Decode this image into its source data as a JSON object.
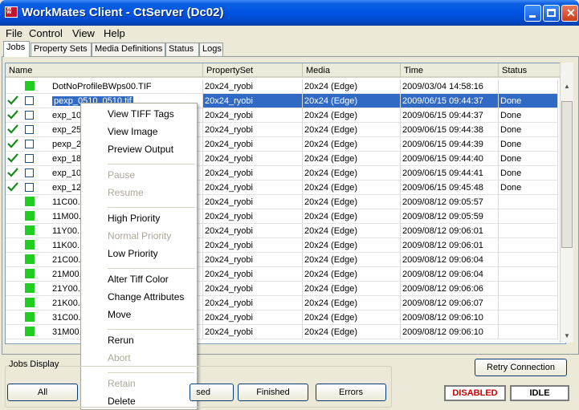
{
  "window": {
    "title": "WorkMates Client - CtServer (Dc02)"
  },
  "menu": [
    "File",
    "Control",
    "View",
    "Help"
  ],
  "tabs": [
    "Jobs",
    "Property Sets",
    "Media Definitions",
    "Status",
    "Logs"
  ],
  "columns": [
    "Name",
    "PropertySet",
    "Media",
    "Time",
    "Status"
  ],
  "rows": [
    {
      "check": false,
      "box": "green",
      "name": "DotNoProfileBWps00.TIF",
      "property_set": "20x24_ryobi",
      "media": "20x24 (Edge)",
      "time": "2009/03/04 14:58:16",
      "status": ""
    },
    {
      "check": true,
      "box": "empty",
      "name": "pexp_0510_0510.tif",
      "property_set": "20x24_ryobi",
      "media": "20x24 (Edge)",
      "time": "2009/06/15 09:44:37",
      "status": "Done"
    },
    {
      "check": true,
      "box": "empty",
      "name": "exp_10",
      "property_set": "20x24_ryobi",
      "media": "20x24 (Edge)",
      "time": "2009/06/15 09:44:37",
      "status": "Done"
    },
    {
      "check": true,
      "box": "empty",
      "name": "exp_25",
      "property_set": "20x24_ryobi",
      "media": "20x24 (Edge)",
      "time": "2009/06/15 09:44:38",
      "status": "Done"
    },
    {
      "check": true,
      "box": "empty",
      "name": "pexp_2",
      "property_set": "20x24_ryobi",
      "media": "20x24 (Edge)",
      "time": "2009/06/15 09:44:39",
      "status": "Done"
    },
    {
      "check": true,
      "box": "empty",
      "name": "exp_18",
      "property_set": "20x24_ryobi",
      "media": "20x24 (Edge)",
      "time": "2009/06/15 09:44:40",
      "status": "Done"
    },
    {
      "check": true,
      "box": "empty",
      "name": "exp_10",
      "property_set": "20x24_ryobi",
      "media": "20x24 (Edge)",
      "time": "2009/06/15 09:44:41",
      "status": "Done"
    },
    {
      "check": true,
      "box": "empty",
      "name": "exp_12",
      "property_set": "20x24_ryobi",
      "media": "20x24 (Edge)",
      "time": "2009/06/15 09:45:48",
      "status": "Done"
    },
    {
      "check": false,
      "box": "green",
      "name": "11C00.",
      "property_set": "20x24_ryobi",
      "media": "20x24 (Edge)",
      "time": "2009/08/12 09:05:57",
      "status": ""
    },
    {
      "check": false,
      "box": "green",
      "name": "11M00.",
      "property_set": "20x24_ryobi",
      "media": "20x24 (Edge)",
      "time": "2009/08/12 09:05:59",
      "status": ""
    },
    {
      "check": false,
      "box": "green",
      "name": "11Y00.",
      "property_set": "20x24_ryobi",
      "media": "20x24 (Edge)",
      "time": "2009/08/12 09:06:01",
      "status": ""
    },
    {
      "check": false,
      "box": "green",
      "name": "11K00.",
      "property_set": "20x24_ryobi",
      "media": "20x24 (Edge)",
      "time": "2009/08/12 09:06:01",
      "status": ""
    },
    {
      "check": false,
      "box": "green",
      "name": "21C00.",
      "property_set": "20x24_ryobi",
      "media": "20x24 (Edge)",
      "time": "2009/08/12 09:06:04",
      "status": ""
    },
    {
      "check": false,
      "box": "green",
      "name": "21M00.",
      "property_set": "20x24_ryobi",
      "media": "20x24 (Edge)",
      "time": "2009/08/12 09:06:04",
      "status": ""
    },
    {
      "check": false,
      "box": "green",
      "name": "21Y00.",
      "property_set": "20x24_ryobi",
      "media": "20x24 (Edge)",
      "time": "2009/08/12 09:06:06",
      "status": ""
    },
    {
      "check": false,
      "box": "green",
      "name": "21K00.",
      "property_set": "20x24_ryobi",
      "media": "20x24 (Edge)",
      "time": "2009/08/12 09:06:07",
      "status": ""
    },
    {
      "check": false,
      "box": "green",
      "name": "31C00.",
      "property_set": "20x24_ryobi",
      "media": "20x24 (Edge)",
      "time": "2009/08/12 09:06:10",
      "status": ""
    },
    {
      "check": false,
      "box": "green",
      "name": "31M00.",
      "property_set": "20x24_ryobi",
      "media": "20x24 (Edge)",
      "time": "2009/08/12 09:06:10",
      "status": ""
    }
  ],
  "context_menu": [
    {
      "label": "View TIFF Tags",
      "enabled": true
    },
    {
      "label": "View Image",
      "enabled": true
    },
    {
      "label": "Preview Output",
      "enabled": true
    },
    {
      "sep": true
    },
    {
      "label": "Pause",
      "enabled": false
    },
    {
      "label": "Resume",
      "enabled": false
    },
    {
      "sep": true
    },
    {
      "label": "High Priority",
      "enabled": true
    },
    {
      "label": "Normal Priority",
      "enabled": false
    },
    {
      "label": "Low Priority",
      "enabled": true
    },
    {
      "sep": true
    },
    {
      "label": "Alter Tiff Color",
      "enabled": true
    },
    {
      "label": "Change Attributes",
      "enabled": true
    },
    {
      "label": "Move",
      "enabled": true
    },
    {
      "sep": true
    },
    {
      "label": "Rerun",
      "enabled": true
    },
    {
      "label": "Abort",
      "enabled": false
    },
    {
      "sep": true
    },
    {
      "label": "Retain",
      "enabled": false
    },
    {
      "label": "Delete",
      "enabled": true
    }
  ],
  "jobs_display": {
    "label": "Jobs Display",
    "buttons": [
      "All",
      "sed",
      "Finished",
      "Errors"
    ]
  },
  "retry_button": "Retry Connection",
  "status": {
    "disabled": "DISABLED",
    "idle": "IDLE"
  },
  "colors": {
    "disabled_text": "#cc0000",
    "selection": "#316ac5",
    "status_green": "#22cc22"
  }
}
